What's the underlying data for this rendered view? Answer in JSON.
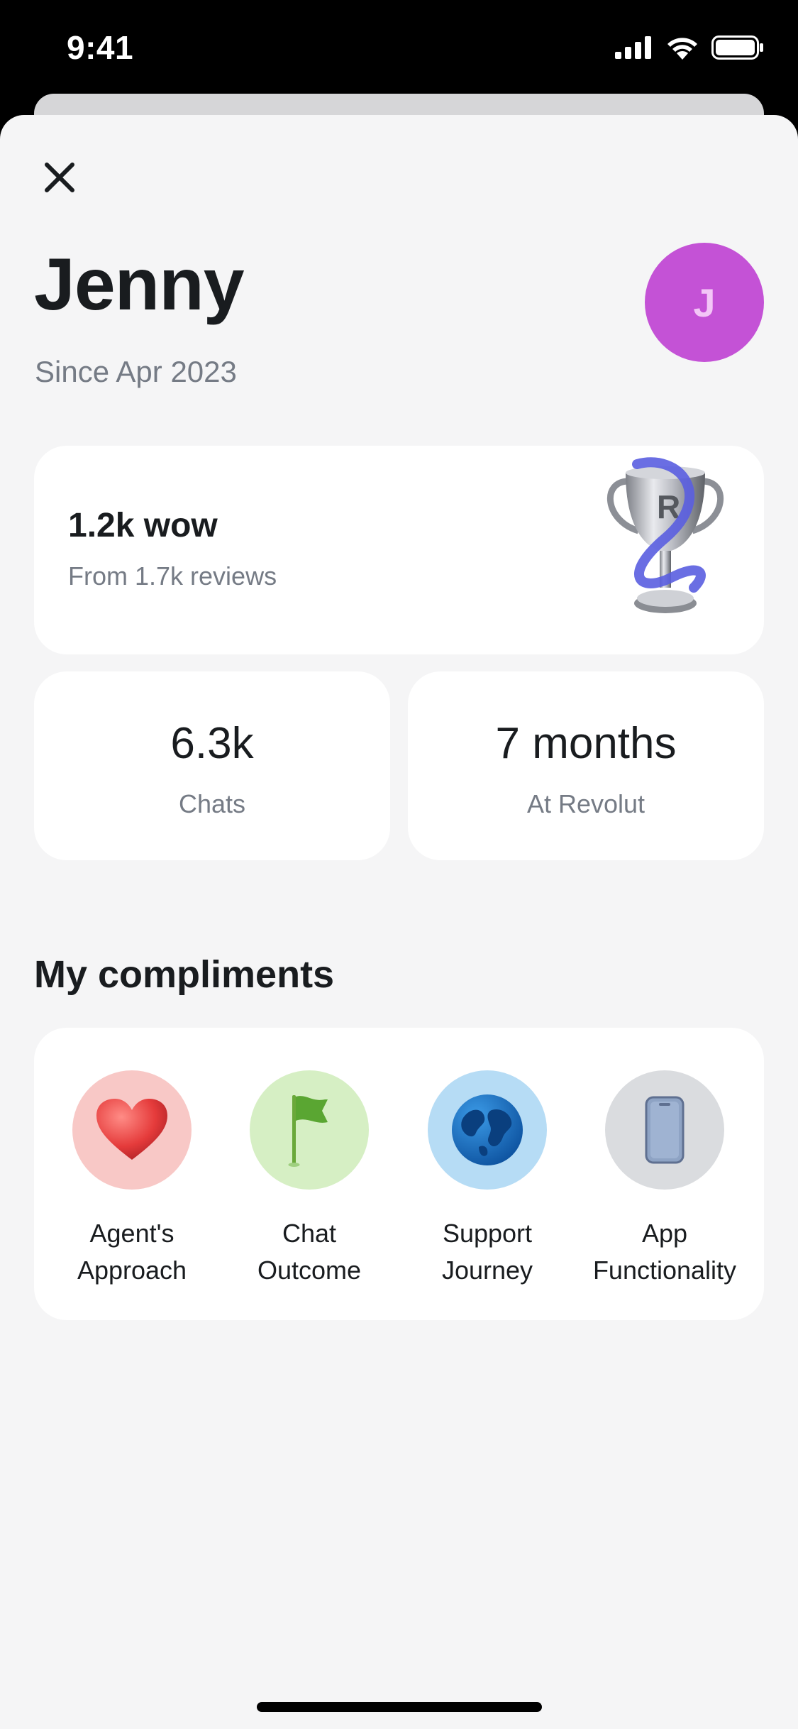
{
  "status": {
    "time": "9:41"
  },
  "profile": {
    "name": "Jenny",
    "since": "Since Apr 2023",
    "avatar_initial": "J",
    "avatar_color": "#c452d6"
  },
  "wow_card": {
    "title": "1.2k wow",
    "subtitle": "From 1.7k reviews",
    "icon": "trophy-icon"
  },
  "stats": [
    {
      "value": "6.3k",
      "label": "Chats"
    },
    {
      "value": "7 months",
      "label": "At Revolut"
    }
  ],
  "compliments": {
    "title": "My compliments",
    "items": [
      {
        "line1": "Agent's",
        "line2": "Approach",
        "icon": "heart-icon",
        "bg": "#f8c8c6"
      },
      {
        "line1": "Chat",
        "line2": "Outcome",
        "icon": "flag-icon",
        "bg": "#d6efc4"
      },
      {
        "line1": "Support",
        "line2": "Journey",
        "icon": "globe-icon",
        "bg": "#b6dcf5"
      },
      {
        "line1": "App",
        "line2": "Functionality",
        "icon": "phone-icon",
        "bg": "#dadcdf"
      }
    ]
  }
}
